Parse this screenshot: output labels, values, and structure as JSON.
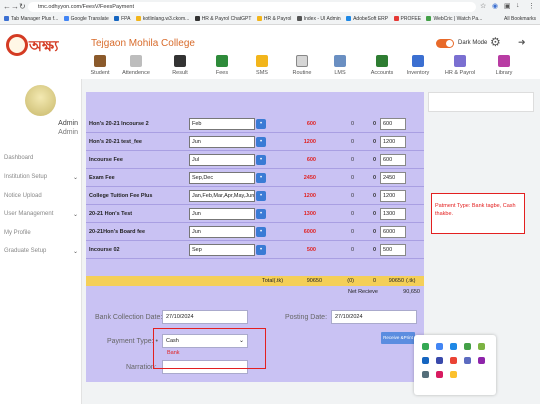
{
  "browser": {
    "url": "tmc.odhyyon.com/FeesV/FeesPayment",
    "bookmarks": [
      "Tab Manager Plus f...",
      "Google Translate",
      "FPA",
      "kotlinlang.w3.ckom...",
      "HR & Payrol ChatGPT",
      "HR & Payrol",
      "Index - UI Admin",
      "AdobeSoft ERP",
      "PROFEE",
      "WebCric | Watch Pa..."
    ],
    "all_bookmarks": "All Bookmarks"
  },
  "header": {
    "logo_text": "অক্ষ্য",
    "college_name": "Tejgaon Mohila College",
    "dark_mode_label": "Dark Mode"
  },
  "nav": [
    {
      "label": "Student",
      "icon": "student-icon",
      "color": "#8b5a2b"
    },
    {
      "label": "Attendence",
      "icon": "attendance-icon",
      "color": "#999999"
    },
    {
      "label": "Result",
      "icon": "graduation-cap-icon",
      "color": "#333333"
    },
    {
      "label": "Fees",
      "icon": "money-icon",
      "color": "#2e8b3a"
    },
    {
      "label": "SMS",
      "icon": "envelope-icon",
      "color": "#f2b51b"
    },
    {
      "label": "Routine",
      "icon": "calendar-icon",
      "color": "#888888"
    },
    {
      "label": "LMS",
      "icon": "books-icon",
      "color": "#6a8fc2"
    },
    {
      "label": "Accounts",
      "icon": "accounts-icon",
      "color": "#2e7d32"
    },
    {
      "label": "Inventory",
      "icon": "inventory-icon",
      "color": "#3b6fd1"
    },
    {
      "label": "HR & Payrol",
      "icon": "hr-icon",
      "color": "#7a6fd1"
    },
    {
      "label": "Library",
      "icon": "library-icon",
      "color": "#b83ca3"
    }
  ],
  "sidebar": {
    "user_name": "Admin",
    "user_role": "Admin",
    "items": [
      {
        "label": "Dashboard",
        "has_chevron": false
      },
      {
        "label": "Institution Setup",
        "has_chevron": true
      },
      {
        "label": "Notice Upload",
        "has_chevron": false
      },
      {
        "label": "User Management",
        "has_chevron": true
      },
      {
        "label": "My Profile",
        "has_chevron": false
      },
      {
        "label": "Graduate Setup",
        "has_chevron": true
      }
    ]
  },
  "fees": {
    "rows": [
      {
        "name": "Hon's 20-21 Incourse 2",
        "month": "Feb",
        "amount": "600",
        "c1": "0",
        "c2": "0",
        "pay": "600"
      },
      {
        "name": "Hon's 20-21 test_fee",
        "month": "Jun",
        "amount": "1200",
        "c1": "0",
        "c2": "0",
        "pay": "1200"
      },
      {
        "name": "Incourse Fee",
        "month": "Jul",
        "amount": "600",
        "c1": "0",
        "c2": "0",
        "pay": "600"
      },
      {
        "name": "Exam Fee",
        "month": "Sep,Dec",
        "amount": "2450",
        "c1": "0",
        "c2": "0",
        "pay": "2450"
      },
      {
        "name": "College Tuition Fee Plus",
        "month": "Jan,Feb,Mar,Apr,May,Jun,Jul",
        "amount": "1200",
        "c1": "0",
        "c2": "0",
        "pay": "1200"
      },
      {
        "name": "20-21 Hon's Test",
        "month": "Jun",
        "amount": "1300",
        "c1": "0",
        "c2": "0",
        "pay": "1300"
      },
      {
        "name": "20-21Hon's Board fee",
        "month": "Jun",
        "amount": "6000",
        "c1": "0",
        "c2": "0",
        "pay": "6000"
      },
      {
        "name": "Incourse 02",
        "month": "Sep",
        "amount": "500",
        "c1": "0",
        "c2": "0",
        "pay": "500"
      }
    ],
    "total_label": "Total(.tk)",
    "total_amount": "90650",
    "total_c1": "(0)",
    "total_c2": "0",
    "total_pay": "90650",
    "total_unit": "(.tk)",
    "net_label": "Net Recieve",
    "net_amount": "90,650"
  },
  "form": {
    "bank_date_label": "Bank Collection Date:",
    "bank_date_value": "27/10/2024",
    "posting_date_label": "Posting Date:",
    "posting_date_value": "27/10/2024",
    "payment_type_label": "Payment Type: •",
    "payment_type_value": "Cash",
    "payment_type_option": "Bank",
    "narration_label": "Narration:",
    "receive_button": "Receive &Print"
  },
  "note": "Patment Type: Bank tagbe, Cash thakbe."
}
